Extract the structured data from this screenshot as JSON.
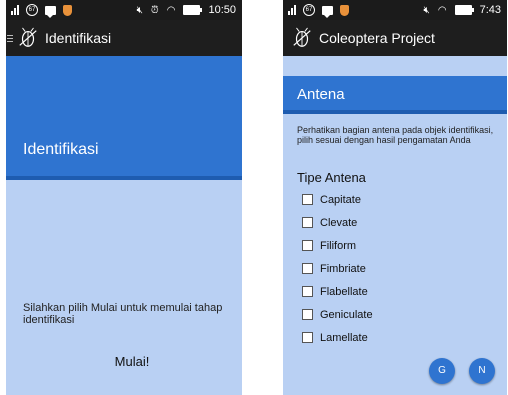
{
  "left": {
    "status": {
      "time": "10:50",
      "badge": "67"
    },
    "app_title": "Identifikasi",
    "banner_title": "Identifikasi",
    "instruction": "Silahkan pilih Mulai untuk memulai tahap identifikasi",
    "start_label": "Mulai!"
  },
  "right": {
    "status": {
      "time": "7:43",
      "badge": "67"
    },
    "app_title": "Coleoptera Project",
    "banner_title": "Antena",
    "instruction": "Perhatikan bagian antena pada objek identifikasi, pilih sesuai dengan hasil pengamatan Anda",
    "section_title": "Tipe Antena",
    "options": [
      "Capitate",
      "Clevate",
      "Filiform",
      "Fimbriate",
      "Flabellate",
      "Geniculate",
      "Lamellate"
    ],
    "fab_g": "G",
    "fab_n": "N"
  },
  "colors": {
    "accent": "#2f74d0",
    "background": "#b9d0f3",
    "bar": "#1e1e1e"
  }
}
